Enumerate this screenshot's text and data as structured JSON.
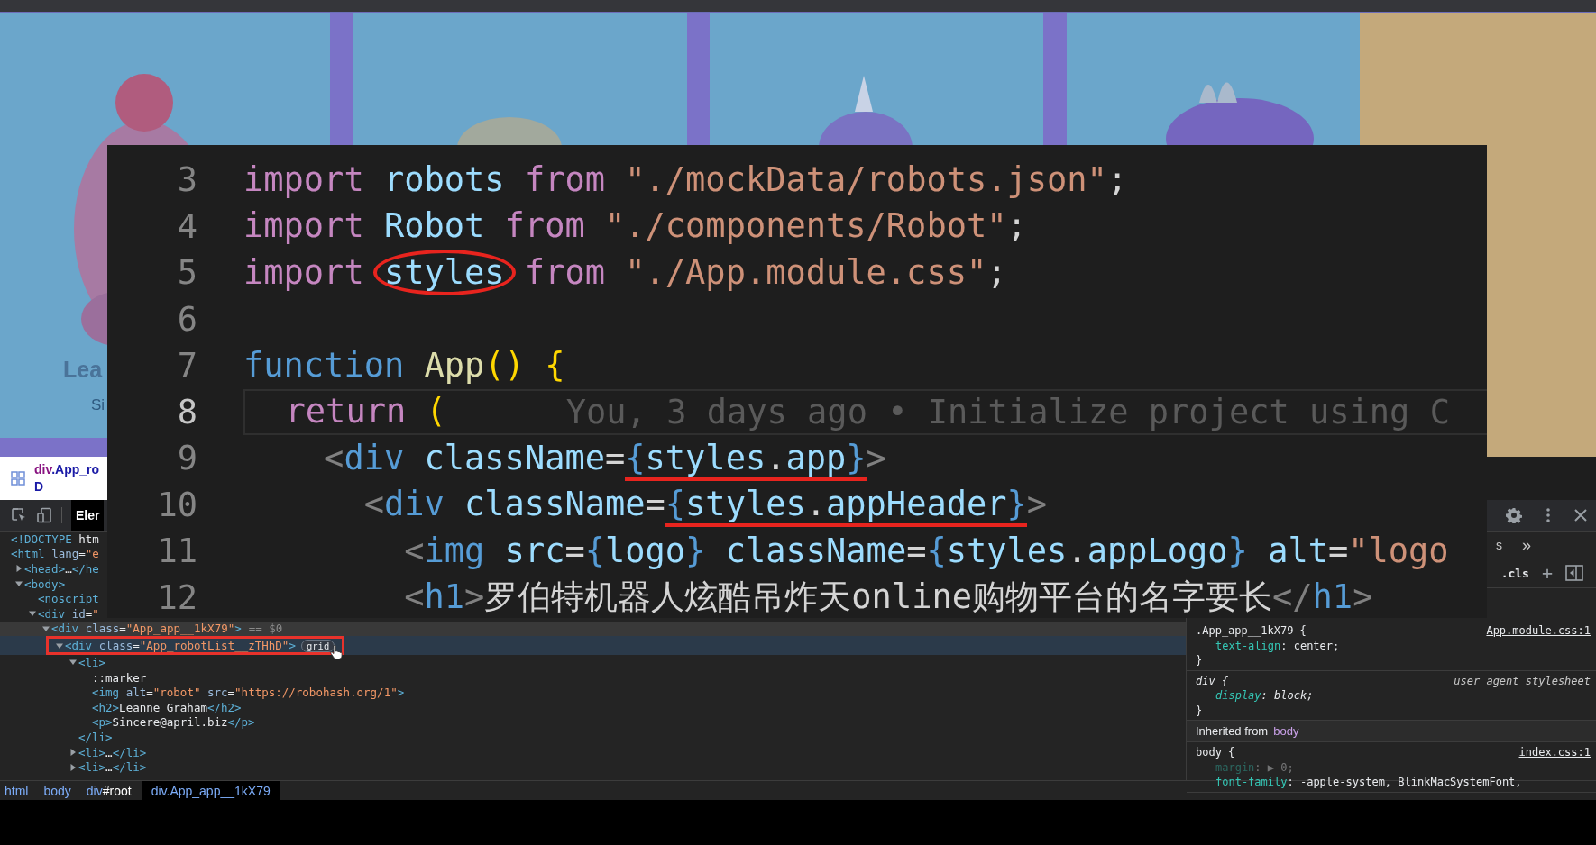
{
  "viewport": {
    "heading": "Lea",
    "subtext": "Si"
  },
  "inspect_tooltip": {
    "lines": [
      "div.App_ro",
      "D"
    ]
  },
  "devtools": {
    "tabs": [
      {
        "label": "Eler",
        "selected": true
      }
    ],
    "sidebar_tab": "s",
    "more_tabs": "»",
    "filter": {
      "cls": ".cls",
      "add": "+"
    },
    "elements": [
      {
        "text": "<!DOCTYPE htm",
        "kind": "leaf",
        "selected": false,
        "hovered": false,
        "annotated": false
      },
      {
        "text": "<html lang=\"e",
        "kind": "leaf",
        "selected": false,
        "hovered": false,
        "annotated": false,
        "children": [
          {
            "text": "<head>…</he",
            "kind": "closed",
            "selected": false,
            "hovered": false,
            "annotated": false
          },
          {
            "text": "<body>",
            "kind": "open",
            "selected": false,
            "hovered": false,
            "annotated": false,
            "children": [
              {
                "text": "<noscript",
                "kind": "leaf",
                "selected": false,
                "hovered": false,
                "annotated": false
              },
              {
                "text": "<div id=\"",
                "kind": "open",
                "selected": false,
                "hovered": false,
                "annotated": false,
                "children": [
                  {
                    "text": "<div class=\"App_app__1kX79\">",
                    "console_ref": "== $0",
                    "kind": "open",
                    "selected": true,
                    "hovered": false,
                    "annotated": false,
                    "children": [
                      {
                        "text": "<div class=\"App_robotList__zTHhD\">",
                        "badge": "grid",
                        "kind": "open",
                        "selected": false,
                        "hovered": true,
                        "annotated": true,
                        "children": [
                          {
                            "text": "<li>",
                            "kind": "open",
                            "selected": false,
                            "hovered": false,
                            "annotated": false,
                            "children": [
                              {
                                "text": "::marker",
                                "kind": "leaf",
                                "selected": false,
                                "hovered": false,
                                "annotated": false
                              },
                              {
                                "text": "<img alt=\"robot\" src=\"https://robohash.org/1\">",
                                "kind": "leaf",
                                "selected": false,
                                "hovered": false,
                                "annotated": false
                              },
                              {
                                "text": "<h2>Leanne Graham</h2>",
                                "kind": "leaf",
                                "selected": false,
                                "hovered": false,
                                "annotated": false
                              },
                              {
                                "text": "<p>Sincere@april.biz</p>",
                                "kind": "leaf",
                                "selected": false,
                                "hovered": false,
                                "annotated": false
                              }
                            ]
                          },
                          {
                            "text": "</li>",
                            "kind": "leaf",
                            "selected": false,
                            "hovered": false,
                            "annotated": false
                          },
                          {
                            "text": "<li>…</li>",
                            "kind": "closed",
                            "selected": false,
                            "hovered": false,
                            "annotated": false
                          },
                          {
                            "text": "<li>…</li>",
                            "kind": "closed",
                            "selected": false,
                            "hovered": false,
                            "annotated": false
                          }
                        ]
                      }
                    ]
                  }
                ]
              }
            ]
          }
        ]
      }
    ],
    "styles": {
      "rules": [
        {
          "selector": ".App_app__1kX79 {",
          "source": "App.module.css:1",
          "user_agent": false,
          "declarations": [
            {
              "text": "text-align: center;",
              "inactive": false
            }
          ],
          "close": "}"
        },
        {
          "selector": "div {",
          "source": "user agent stylesheet",
          "user_agent": true,
          "declarations": [
            {
              "text": "display: block;",
              "inactive": false
            }
          ],
          "close": "}"
        }
      ],
      "inherited": {
        "label": "Inherited from",
        "element": "body"
      },
      "inherited_rules": [
        {
          "selector": "body {",
          "source": "index.css:1",
          "user_agent": false,
          "declarations": [
            {
              "text": "margin: ▶ 0;",
              "inactive": true
            },
            {
              "text": "font-family: -apple-system, BlinkMacSystemFont,",
              "inactive": false
            }
          ]
        }
      ]
    },
    "breadcrumbs": [
      {
        "label": "html",
        "selected": false
      },
      {
        "label": "body",
        "selected": false
      },
      {
        "label": "div#root",
        "selected": false
      },
      {
        "label": "div.App_app__1kX79",
        "selected": true
      }
    ]
  },
  "editor": {
    "lines": [
      {
        "number": "3",
        "current": false,
        "segments": [
          {
            "text": "import ",
            "kind": "kw"
          },
          {
            "text": "robots ",
            "kind": "var"
          },
          {
            "text": "from ",
            "kind": "kw"
          },
          {
            "text": "\"./mockData/robots.json\"",
            "kind": "str"
          },
          {
            "text": ";",
            "kind": "pl"
          }
        ]
      },
      {
        "number": "4",
        "current": false,
        "segments": [
          {
            "text": "import ",
            "kind": "kw"
          },
          {
            "text": "Robot ",
            "kind": "var"
          },
          {
            "text": "from ",
            "kind": "kw"
          },
          {
            "text": "\"./components/Robot\"",
            "kind": "str"
          },
          {
            "text": ";",
            "kind": "pl"
          }
        ]
      },
      {
        "number": "5",
        "current": false,
        "segments": [
          {
            "text": "import ",
            "kind": "kw"
          },
          {
            "text": "styles",
            "kind": "var",
            "circled": true
          },
          {
            "text": " from ",
            "kind": "kw"
          },
          {
            "text": "\"./App.module.css\"",
            "kind": "str"
          },
          {
            "text": ";",
            "kind": "pl"
          }
        ]
      },
      {
        "number": "6",
        "current": false
      },
      {
        "number": "7",
        "current": false,
        "segments": [
          {
            "text": "function ",
            "kind": "decl"
          },
          {
            "text": "App",
            "kind": "fn"
          },
          {
            "text": "() {",
            "kind": "br"
          }
        ]
      },
      {
        "number": "8",
        "current": true,
        "segments": [
          {
            "text": "  return ",
            "kind": "kw"
          },
          {
            "text": "(",
            "kind": "br"
          }
        ],
        "blame": "You, 3 days ago • Initialize project using C"
      },
      {
        "number": "9",
        "current": false,
        "segments": [
          {
            "text": "    <",
            "kind": "punct"
          },
          {
            "text": "div ",
            "kind": "tag"
          },
          {
            "text": "className",
            "kind": "var"
          },
          {
            "text": "=",
            "kind": "pl"
          },
          {
            "text": "{",
            "kind": "br2",
            "underlined": true
          },
          {
            "text": "styles",
            "kind": "var",
            "underlined": true
          },
          {
            "text": ".",
            "kind": "pl",
            "underlined": true
          },
          {
            "text": "app",
            "kind": "var",
            "underlined": true
          },
          {
            "text": "}",
            "kind": "br2",
            "underlined": true
          },
          {
            "text": ">",
            "kind": "punct"
          }
        ]
      },
      {
        "number": "10",
        "current": false,
        "segments": [
          {
            "text": "      <",
            "kind": "punct"
          },
          {
            "text": "div ",
            "kind": "tag"
          },
          {
            "text": "className",
            "kind": "var"
          },
          {
            "text": "=",
            "kind": "pl"
          },
          {
            "text": "{",
            "kind": "br2",
            "underlined": true
          },
          {
            "text": "styles",
            "kind": "var",
            "underlined": true
          },
          {
            "text": ".",
            "kind": "pl",
            "underlined": true
          },
          {
            "text": "appHeader",
            "kind": "var",
            "underlined": true
          },
          {
            "text": "}",
            "kind": "br2",
            "underlined": true
          },
          {
            "text": ">",
            "kind": "punct"
          }
        ]
      },
      {
        "number": "11",
        "current": false,
        "segments": [
          {
            "text": "        <",
            "kind": "punct"
          },
          {
            "text": "img ",
            "kind": "tag"
          },
          {
            "text": "src",
            "kind": "var"
          },
          {
            "text": "=",
            "kind": "pl"
          },
          {
            "text": "{",
            "kind": "br2"
          },
          {
            "text": "logo",
            "kind": "var"
          },
          {
            "text": "} ",
            "kind": "br2"
          },
          {
            "text": "className",
            "kind": "var"
          },
          {
            "text": "=",
            "kind": "pl"
          },
          {
            "text": "{",
            "kind": "br2"
          },
          {
            "text": "styles",
            "kind": "var"
          },
          {
            "text": ".",
            "kind": "pl"
          },
          {
            "text": "appLogo",
            "kind": "var"
          },
          {
            "text": "} ",
            "kind": "br2"
          },
          {
            "text": "alt",
            "kind": "var"
          },
          {
            "text": "=",
            "kind": "pl"
          },
          {
            "text": "\"logo",
            "kind": "str"
          }
        ]
      },
      {
        "number": "12",
        "current": false,
        "segments": [
          {
            "text": "        <",
            "kind": "punct"
          },
          {
            "text": "h1",
            "kind": "tag"
          },
          {
            "text": ">",
            "kind": "punct"
          },
          {
            "text": "罗伯特机器人炫酷吊炸天online购物平台的名字要长",
            "kind": "pl"
          },
          {
            "text": "</",
            "kind": "punct"
          },
          {
            "text": "h1",
            "kind": "tag"
          },
          {
            "text": ">",
            "kind": "punct"
          }
        ]
      }
    ]
  }
}
